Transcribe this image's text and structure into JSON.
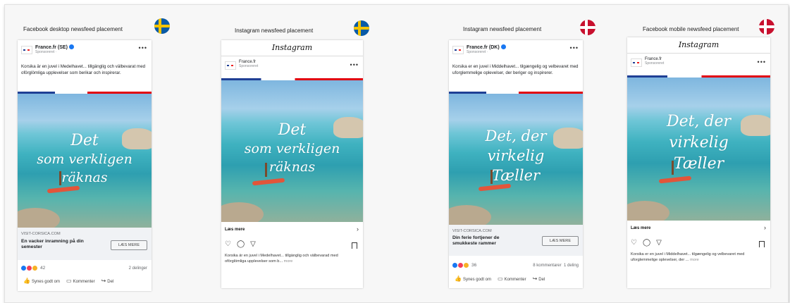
{
  "panels": [
    {
      "title": "Facebook desktop newsfeed placement"
    },
    {
      "title": "Instagram newsfeed placement"
    },
    {
      "title": "Instagram newsfeed placement"
    },
    {
      "title": "Facebook mobile newsfeed placement"
    }
  ],
  "fb_desktop": {
    "account": "France.fr (SE)",
    "sponsored": "Sponsoreret · ",
    "caption": "Korsika är en juvel i Medelhavet... tillgänglig och välbevarat med oförglömliga upplevelser som berikar och inspirerar.",
    "script_lines": [
      "Det",
      "som verkligen",
      "räknas"
    ],
    "domain": "VISIT-CORSICA.COM",
    "headline": "En vacker inramning på din semester",
    "cta": "LÆS MERE",
    "reaction_count": "42",
    "shares": "2 delinger",
    "like": "Synes godt om",
    "comment": "Kommenter",
    "share": "Del"
  },
  "ig_se": {
    "header": "Instagram",
    "account": "France.fr",
    "sponsored": "Sponsoreret",
    "script_lines": [
      "Det",
      "som verkligen",
      "räknas"
    ],
    "link": "Læs mere",
    "caption": "Korsika är en juvel i Medelhavet... tillgänglig och välbevarad med oförglömliga upplevelser som b...",
    "more": "more"
  },
  "ig_dk_fbstyle": {
    "account": "France.fr (DK)",
    "sponsored": "Sponsoreret · ",
    "caption": "Korsika er en juvel i Middelhavet... tilgængelig og velbevaret med uforglemmelige oplevelser, der beriger og inspirerer.",
    "script_lines": [
      "Det, der",
      "virkelig",
      "Tæller"
    ],
    "domain": "VISIT-CORSICA.COM",
    "headline": "Din ferie fortjener de smukkeste rammer",
    "cta": "LÆS MERE",
    "reaction_count": "36",
    "counts": "8 kommentarer  1 deling",
    "like": "Synes godt om",
    "comment": "Kommenter",
    "share": "Del"
  },
  "fb_mobile": {
    "header": "Instagram",
    "account": "France.fr",
    "sponsored": "Sponsoreret",
    "script_lines": [
      "Det, der",
      "virkelig",
      "Tæller"
    ],
    "link": "Læs mere",
    "caption": "Korsika er en juvel i Middelhavet... tilgængelig og velbevaret med uforglemmelige oplevelser, der ...",
    "more": "more"
  },
  "colors": {
    "facebook_blue": "#1877f2",
    "france_blue": "#1f3f95",
    "france_red": "#e1000f"
  }
}
